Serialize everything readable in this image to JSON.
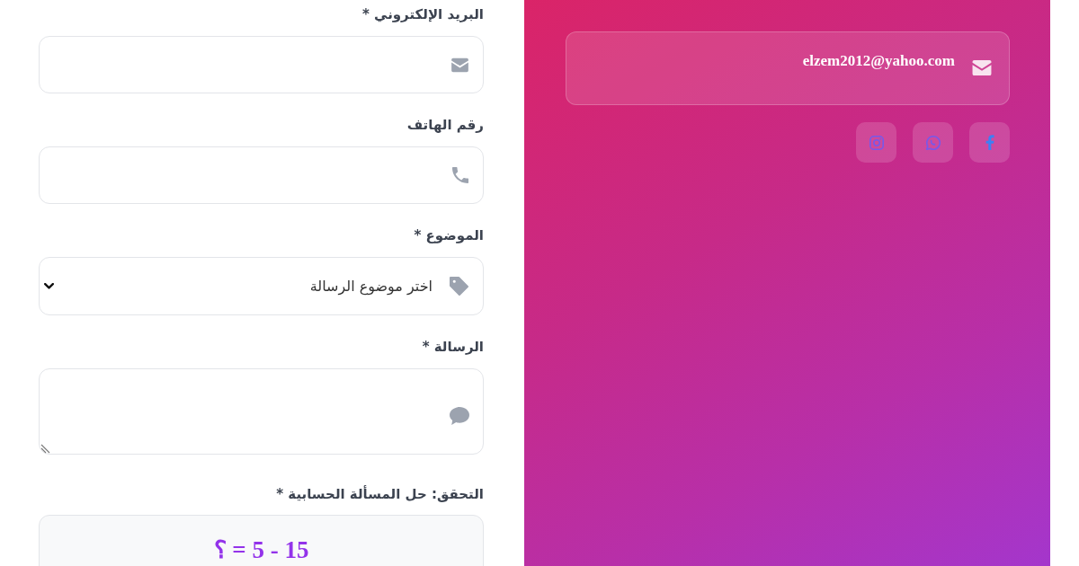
{
  "contact_panel": {
    "contacts": [
      {
        "kind": "email",
        "value": "elzem2012@yahoo.com"
      }
    ],
    "social_links": [
      {
        "kind": "facebook"
      },
      {
        "kind": "whatsapp"
      },
      {
        "kind": "instagram"
      }
    ]
  },
  "form": {
    "fields": [
      {
        "kind": "email",
        "label": "البريد الإلكتروني *"
      },
      {
        "kind": "tel",
        "label": "رقم الهاتف"
      },
      {
        "kind": "select",
        "label": "الموضوع *",
        "value": "اختر موضوع الرسالة"
      },
      {
        "kind": "textarea",
        "label": "الرسالة *"
      }
    ],
    "captcha": {
      "label": "التحقق: حل المسألة الحسابية *",
      "question": "15 - 5 = ؟"
    }
  }
}
